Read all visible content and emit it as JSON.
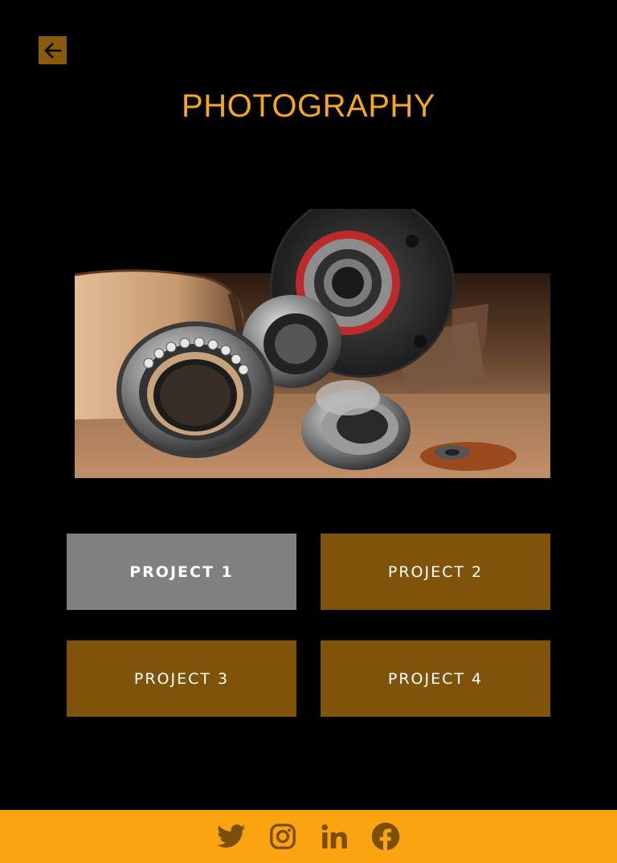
{
  "header": {
    "back_icon": "arrow-left-icon",
    "title": "PHOTOGRAPHY"
  },
  "hero": {
    "subject": "bearings-photo"
  },
  "projects": [
    {
      "label": "PROJECT 1",
      "active": true
    },
    {
      "label": "PROJECT 2",
      "active": false
    },
    {
      "label": "PROJECT 3",
      "active": false
    },
    {
      "label": "PROJECT 4",
      "active": false
    }
  ],
  "footer": {
    "icons": [
      "twitter-icon",
      "instagram-icon",
      "linkedin-icon",
      "facebook-icon"
    ]
  },
  "colors": {
    "background": "#000000",
    "accent": "#f5a623",
    "button": "#80530a",
    "button_active": "#808080",
    "footer": "#fca311",
    "icon": "#7a4f0a"
  }
}
